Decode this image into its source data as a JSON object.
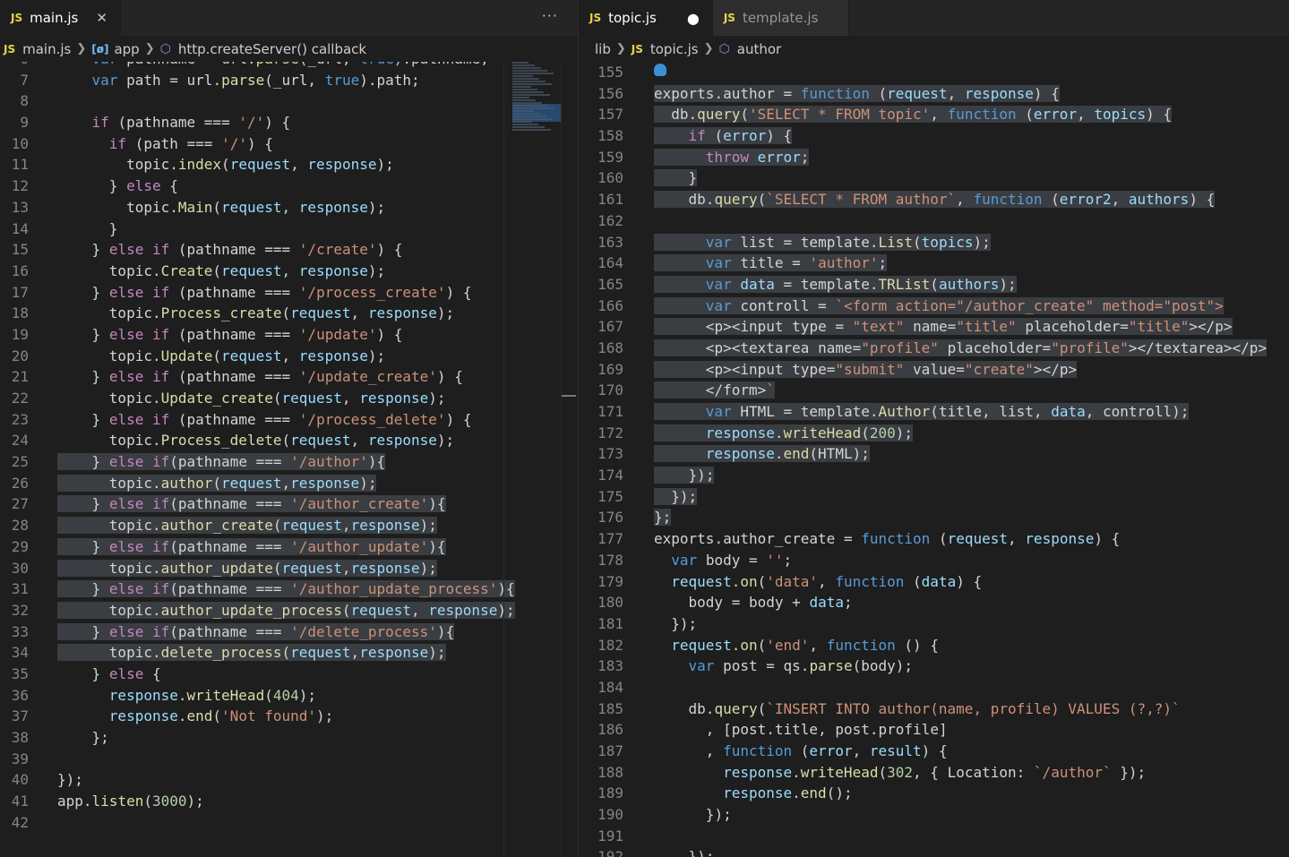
{
  "left": {
    "tabs": [
      {
        "icon": "JS",
        "label": "main.js"
      }
    ],
    "breadcrumb": {
      "file": "main.js",
      "var": "app",
      "symbol": "http.createServer() callback"
    },
    "first_line_number": 6,
    "lines": [
      "    var pathname = url.parse(_url, true).pathname;",
      "    var path = url.parse(_url, true).path;",
      "",
      "    if (pathname === '/') {",
      "      if (path === '/') {",
      "        topic.index(request, response);",
      "      } else {",
      "        topic.Main(request, response);",
      "      }",
      "    } else if (pathname === '/create') {",
      "      topic.Create(request, response);",
      "    } else if (pathname === '/process_create') {",
      "      topic.Process_create(request, response);",
      "    } else if (pathname === '/update') {",
      "      topic.Update(request, response);",
      "    } else if (pathname === '/update_create') {",
      "      topic.Update_create(request, response);",
      "    } else if (pathname === '/process_delete') {",
      "      topic.Process_delete(request, response);",
      "    } else if(pathname === '/author'){",
      "      topic.author(request,response);",
      "    } else if(pathname === '/author_create'){",
      "      topic.author_create(request,response);",
      "    } else if(pathname === '/author_update'){",
      "      topic.author_update(request,response);",
      "    } else if(pathname === '/author_update_process'){",
      "      topic.author_update_process(request, response);",
      "    } else if(pathname === '/delete_process'){",
      "      topic.delete_process(request,response);",
      "    } else {",
      "      response.writeHead(404);",
      "      response.end('Not found');",
      "    };",
      "",
      "});",
      "app.listen(3000);",
      ""
    ]
  },
  "right": {
    "tabs": [
      {
        "icon": "JS",
        "label": "topic.js",
        "modified": true
      },
      {
        "icon": "JS",
        "label": "template.js"
      }
    ],
    "breadcrumb": {
      "folder": "lib",
      "file": "topic.js",
      "symbol": "author"
    },
    "first_line_number": 155,
    "lines": [
      "",
      "exports.author = function (request, response) {",
      "  db.query('SELECT * FROM topic', function (error, topics) {",
      "    if (error) {",
      "      throw error;",
      "    }",
      "    db.query(`SELECT * FROM author`, function (error2, authors) {",
      "",
      "      var list = template.List(topics);",
      "      var title = 'author';",
      "      var data = template.TRList(authors);",
      "      var controll = `<form action=\"/author_create\" method=\"post\">",
      "      <p><input type = \"text\" name=\"title\" placeholder=\"title\"></p>",
      "      <p><textarea name=\"profile\" placeholder=\"profile\"></textarea></p>",
      "      <p><input type=\"submit\" value=\"create\"></p>",
      "      </form>`",
      "      var HTML = template.Author(title, list, data, controll);",
      "      response.writeHead(200);",
      "      response.end(HTML);",
      "    });",
      "  });",
      "};",
      "exports.author_create = function (request, response) {",
      "  var body = '';",
      "  request.on('data', function (data) {",
      "    body = body + data;",
      "  });",
      "  request.on('end', function () {",
      "    var post = qs.parse(body);",
      "",
      "    db.query(`INSERT INTO author(name, profile) VALUES (?,?)`",
      "      , [post.title, post.profile]",
      "      , function (error, result) {",
      "        response.writeHead(302, { Location: `/author` });",
      "        response.end();",
      "      });",
      "",
      "    });"
    ]
  },
  "colors": {
    "background": "#1e1e1e",
    "tabbar": "#252526",
    "selection": "#3a3d41",
    "keyword": "#569cd6",
    "control": "#c586c0",
    "function": "#dcdcaa",
    "string": "#ce9178",
    "number": "#b5cea8",
    "js_badge": "#e8d44d"
  },
  "icons": [
    "js-file-icon",
    "close-icon",
    "more-actions-icon",
    "modified-dot-icon",
    "variable-icon",
    "symbol-cube-icon",
    "chevron-right-icon",
    "lightbulb-icon"
  ]
}
